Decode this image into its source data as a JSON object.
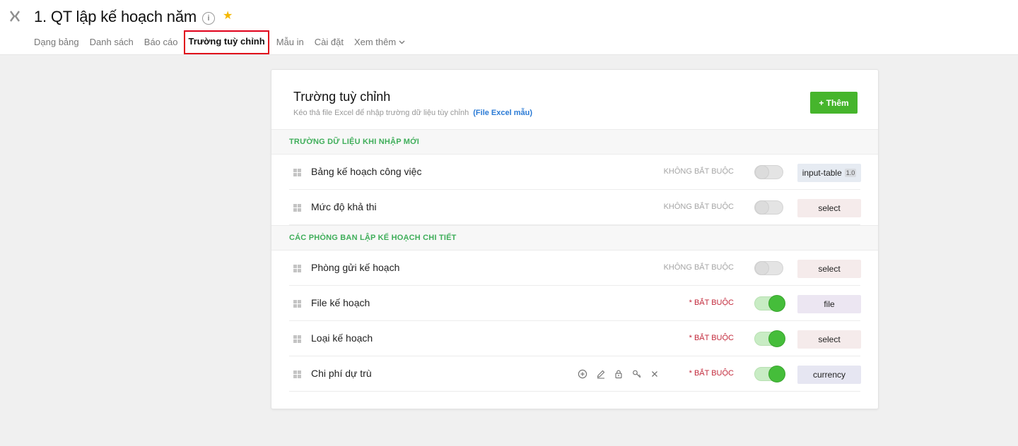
{
  "header": {
    "title": "1. QT lập kế hoạch năm",
    "back_icon": "collapse-arrows-icon",
    "info_icon": "i",
    "star_icon": "★",
    "tabs": [
      {
        "label": "Dạng bảng"
      },
      {
        "label": "Danh sách"
      },
      {
        "label": "Báo cáo"
      },
      {
        "label": "Trường tuỳ chỉnh",
        "active": true
      },
      {
        "label": "Mẫu in"
      },
      {
        "label": "Cài đặt"
      },
      {
        "label": "Xem thêm"
      }
    ]
  },
  "card": {
    "title": "Trường tuỳ chỉnh",
    "subtitle": "Kéo thả file Excel để nhập trường dữ liệu tùy chỉnh",
    "subtitle_link": "(File Excel mẫu)",
    "add_button": "+ Thêm"
  },
  "sections": [
    {
      "title": "TRƯỜNG DỮ LIỆU KHI NHẬP MỚI",
      "rows": [
        {
          "label": "Bảng kế hoạch công việc",
          "requirement": "KHÔNG BẮT BUỘC",
          "required": false,
          "type": "input-table",
          "version": "1.0"
        },
        {
          "label": "Mức độ khả thi",
          "requirement": "KHÔNG BẮT BUỘC",
          "required": false,
          "type": "select"
        }
      ]
    },
    {
      "title": "CÁC PHÒNG BAN LẬP KẾ HOẠCH CHI TIẾT",
      "rows": [
        {
          "label": "Phòng gửi kế hoạch",
          "requirement": "KHÔNG BẮT BUỘC",
          "required": false,
          "type": "select"
        },
        {
          "label": "File kế hoạch",
          "requirement": "* BẮT BUỘC",
          "required": true,
          "type": "file"
        },
        {
          "label": "Loại kế hoạch",
          "requirement": "* BẮT BUỘC",
          "required": true,
          "type": "select"
        },
        {
          "label": "Chi phí dự trù",
          "requirement": "* BẮT BUỘC",
          "required": true,
          "type": "currency",
          "actions": [
            "add-circle-icon",
            "edit-icon",
            "lock-icon",
            "key-icon",
            "close-icon"
          ]
        }
      ]
    }
  ],
  "colors": {
    "accent_green": "#46b52c",
    "section_green": "#3fae5a",
    "required_red": "#c2283a",
    "link_blue": "#2a7ad5",
    "badge_input_table": "#e6ebf2",
    "badge_select": "#f5ebeb",
    "badge_file": "#ece6f2",
    "badge_currency": "#e6e6f2"
  }
}
